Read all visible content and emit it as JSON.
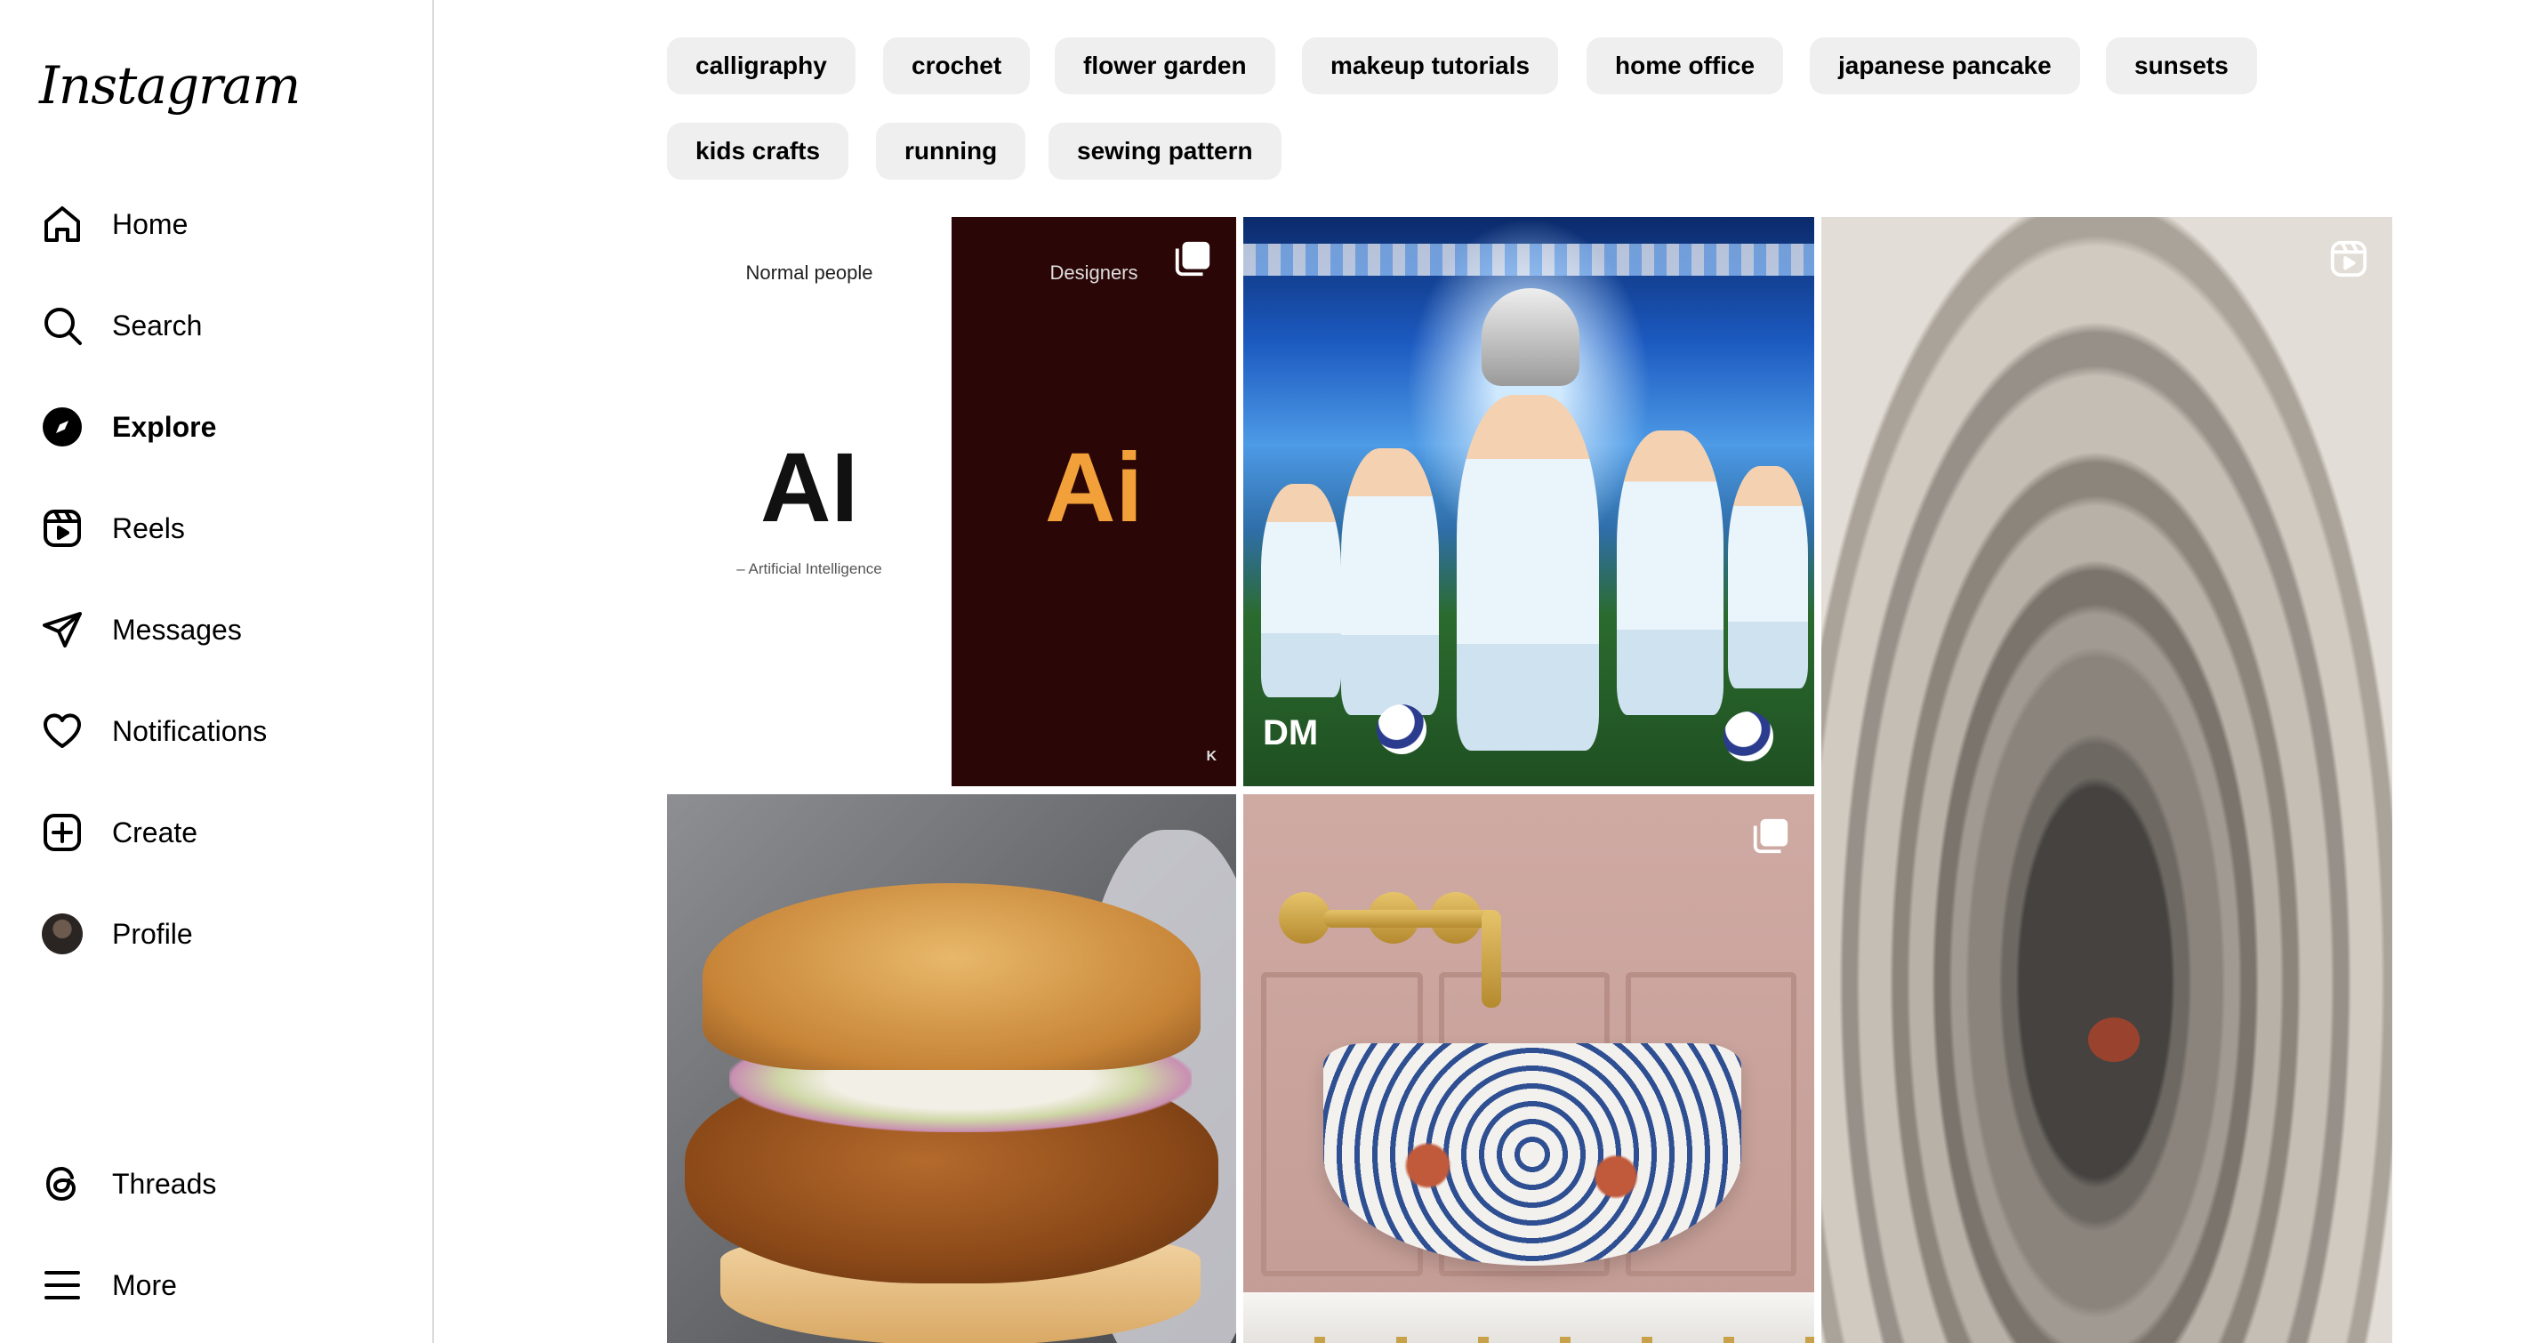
{
  "sidebar": {
    "logo": "Instagram",
    "nav": [
      {
        "label": "Home",
        "icon": "home-icon"
      },
      {
        "label": "Search",
        "icon": "search-icon"
      },
      {
        "label": "Explore",
        "icon": "explore-icon",
        "active": true
      },
      {
        "label": "Reels",
        "icon": "reels-icon"
      },
      {
        "label": "Messages",
        "icon": "messages-icon"
      },
      {
        "label": "Notifications",
        "icon": "heart-icon"
      },
      {
        "label": "Create",
        "icon": "create-icon"
      },
      {
        "label": "Profile",
        "icon": "avatar"
      }
    ],
    "bottom": [
      {
        "label": "Threads",
        "icon": "threads-icon"
      },
      {
        "label": "More",
        "icon": "menu-icon"
      }
    ]
  },
  "topics": [
    "calligraphy",
    "crochet",
    "flower garden",
    "makeup tutorials",
    "home office",
    "japanese pancake",
    "sunsets",
    "kids crafts",
    "running",
    "sewing pattern"
  ],
  "grid": {
    "meme": {
      "left_caption": "Normal people",
      "left_big": "AI",
      "left_sub": "– Artificial Intelligence",
      "right_caption": "Designers",
      "right_big": "Ai",
      "watermark": "K"
    },
    "football": {
      "logo": "DM"
    },
    "badges": {
      "carousel": "carousel-icon",
      "reel": "reels-icon"
    }
  },
  "colors": {
    "chip_bg": "#efefef",
    "border": "#dbdbdb",
    "text": "#000000"
  }
}
